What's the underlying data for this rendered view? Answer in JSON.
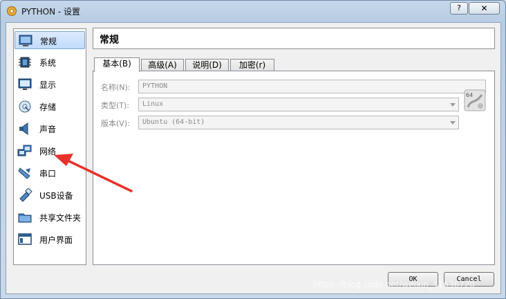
{
  "window": {
    "title": "PYTHON - 设置",
    "help_label": "?",
    "close_label": "✕"
  },
  "sidebar": {
    "items": [
      {
        "label": "常规",
        "icon": "general-icon"
      },
      {
        "label": "系统",
        "icon": "system-chip-icon"
      },
      {
        "label": "显示",
        "icon": "display-monitor-icon"
      },
      {
        "label": "存储",
        "icon": "storage-disk-icon"
      },
      {
        "label": "声音",
        "icon": "speaker-icon"
      },
      {
        "label": "网络",
        "icon": "network-icon"
      },
      {
        "label": "串口",
        "icon": "serial-port-icon"
      },
      {
        "label": "USB设备",
        "icon": "usb-icon"
      },
      {
        "label": "共享文件夹",
        "icon": "shared-folder-icon"
      },
      {
        "label": "用户界面",
        "icon": "user-interface-icon"
      }
    ],
    "selected": "常规"
  },
  "header": {
    "title": "常规"
  },
  "tabs": [
    {
      "label": "基本(B)"
    },
    {
      "label": "高级(A)"
    },
    {
      "label": "说明(D)"
    },
    {
      "label": "加密(r)"
    }
  ],
  "basic": {
    "name_label": "名称(N):",
    "name_value": "PYTHON",
    "type_label": "类型(T):",
    "type_value": "Linux",
    "version_label": "版本(V):",
    "version_value": "Ubuntu (64-bit)",
    "os_badge": "64"
  },
  "buttons": {
    "ok": "OK",
    "cancel": "Cancel"
  },
  "watermark": "https://blog.csdn.net/weixin_41636720",
  "colors": {
    "selection": "#c1dbfc",
    "annotation": "#e8312a"
  }
}
